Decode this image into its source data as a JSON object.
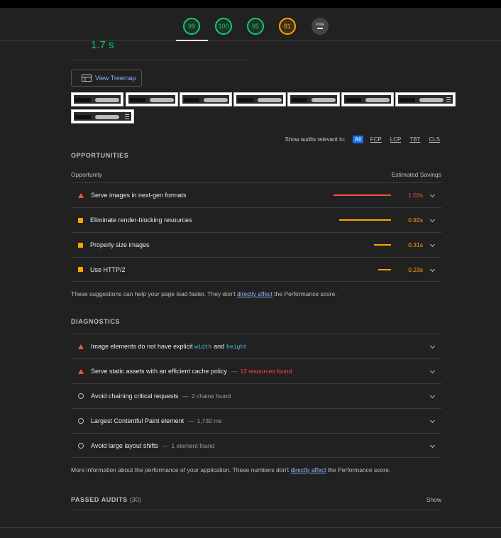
{
  "gauges": [
    {
      "score": "99"
    },
    {
      "score": "100"
    },
    {
      "score": "95"
    },
    {
      "score": "81"
    }
  ],
  "pwa_badge": {
    "label": "PWA"
  },
  "metric": {
    "value": "1.7 s"
  },
  "treemap_button": {
    "label": "View Treemap"
  },
  "filter": {
    "label": "Show audits relevant to:",
    "chips": [
      "All",
      "FCP",
      "LCP",
      "TBT",
      "CLS"
    ],
    "active": "All"
  },
  "opportunities": {
    "title": "OPPORTUNITIES",
    "col_left": "Opportunity",
    "col_right": "Estimated Savings",
    "items": [
      {
        "title": "Serve images in next-gen formats",
        "saving": "1.03s",
        "rating": "fail",
        "fraction": 1.0
      },
      {
        "title": "Eliminate render-blocking resources",
        "saving": "0.92s",
        "rating": "average",
        "fraction": 0.9
      },
      {
        "title": "Properly size images",
        "saving": "0.31s",
        "rating": "average",
        "fraction": 0.3
      },
      {
        "title": "Use HTTP/2",
        "saving": "0.23s",
        "rating": "average",
        "fraction": 0.22
      }
    ],
    "note_prefix": "These suggestions can help your page load faster. They don't ",
    "note_link": "directly affect",
    "note_suffix": " the Performance score."
  },
  "diagnostics": {
    "title": "DIAGNOSTICS",
    "items": [
      {
        "title": "Image elements do not have explicit ",
        "code1": "width",
        "and": "and",
        "code2": "height",
        "rating": "fail"
      },
      {
        "title": "Serve static assets with an efficient cache policy",
        "detail": "12 resources found",
        "rating": "fail"
      },
      {
        "title": "Avoid chaining critical requests",
        "detail": "2 chains found",
        "rating": "info"
      },
      {
        "title": "Largest Contentful Paint element",
        "detail": "1,730 ms",
        "rating": "info"
      },
      {
        "title": "Avoid large layout shifts",
        "detail": "1 element found",
        "rating": "info"
      }
    ],
    "note_prefix": "More information about the performance of your application. These numbers don't ",
    "note_link": "directly affect",
    "note_suffix": " the Performance score."
  },
  "passed_audits": {
    "title": "PASSED AUDITS",
    "count": "(30)",
    "show_label": "Show"
  },
  "colors": {
    "pass": "#0cce6b",
    "average": "#ffa400",
    "fail": "#ff4e42",
    "link": "#8ab4f8",
    "background": "#212121"
  }
}
